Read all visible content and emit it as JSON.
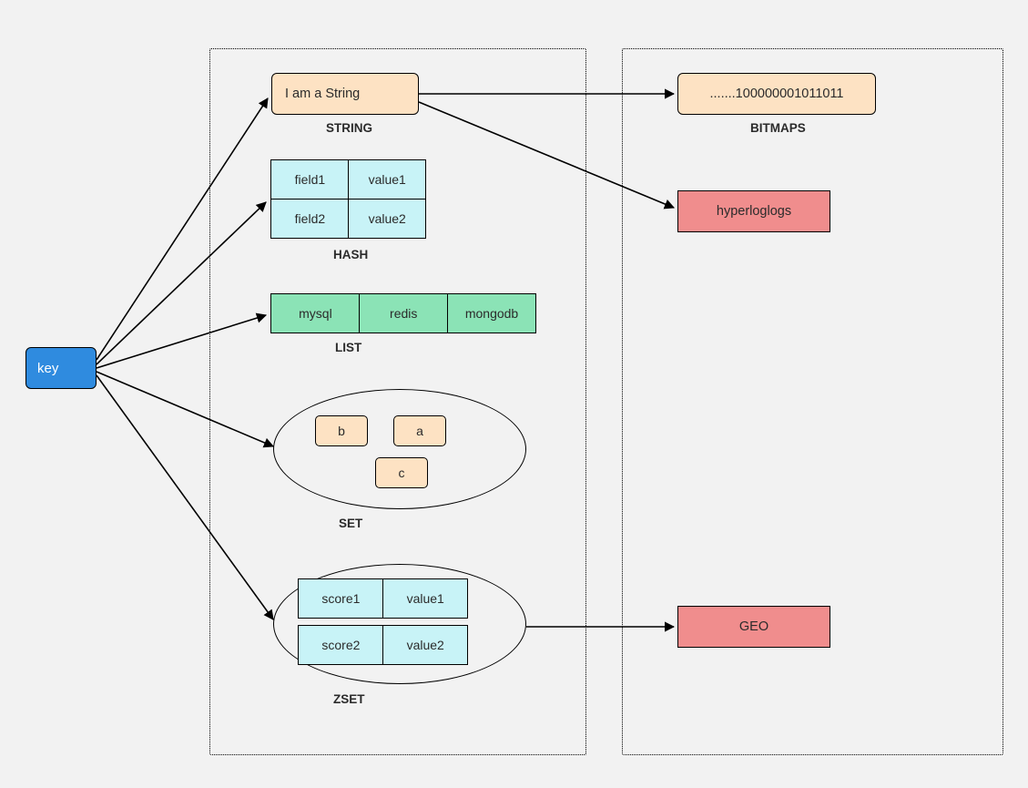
{
  "key": {
    "label": "key"
  },
  "containers": {
    "left": "",
    "right": ""
  },
  "types": {
    "string": {
      "value": "I am a String",
      "label": "STRING"
    },
    "hash": {
      "rows": [
        [
          "field1",
          "value1"
        ],
        [
          "field2",
          "value2"
        ]
      ],
      "label": "HASH"
    },
    "list": {
      "items": [
        "mysql",
        "redis",
        "mongodb"
      ],
      "label": "LIST"
    },
    "set": {
      "items": [
        "b",
        "a",
        "c"
      ],
      "label": "SET"
    },
    "zset": {
      "rows": [
        [
          "score1",
          "value1"
        ],
        [
          "score2",
          "value2"
        ]
      ],
      "label": "ZSET"
    }
  },
  "derived": {
    "bitmaps": {
      "value": ".......100000001011011",
      "label": "BITMAPS"
    },
    "hyperloglogs": {
      "value": "hyperloglogs"
    },
    "geo": {
      "value": "GEO"
    }
  }
}
